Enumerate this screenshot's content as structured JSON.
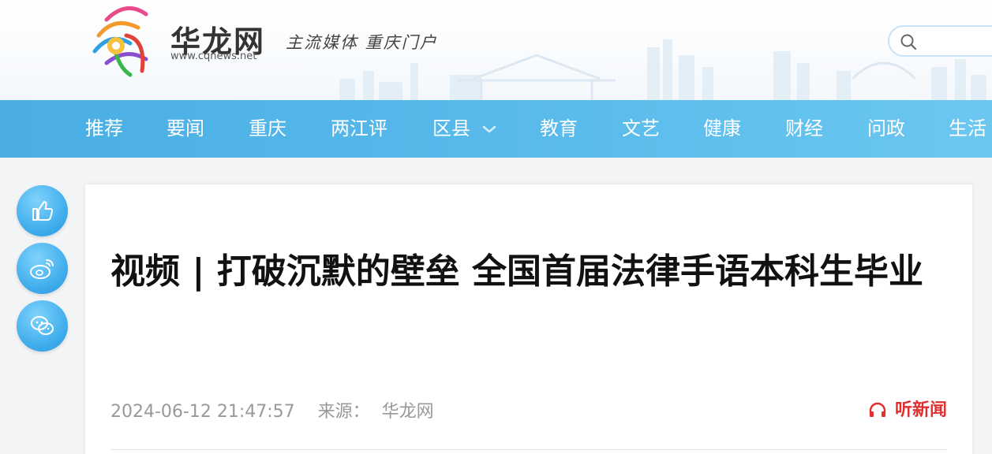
{
  "site": {
    "name": "华龙网",
    "url": "www.cqnews.net",
    "slogan": "主流媒体 重庆门户"
  },
  "search": {
    "placeholder": ""
  },
  "nav": {
    "items": [
      {
        "label": "推荐"
      },
      {
        "label": "要闻"
      },
      {
        "label": "重庆"
      },
      {
        "label": "两江评"
      },
      {
        "label": "区县",
        "has_dropdown": true
      },
      {
        "label": "教育"
      },
      {
        "label": "文艺"
      },
      {
        "label": "健康"
      },
      {
        "label": "财经"
      },
      {
        "label": "问政"
      },
      {
        "label": "生活"
      }
    ]
  },
  "share": {
    "items": [
      {
        "icon": "thumbs-up-icon"
      },
      {
        "icon": "weibo-icon"
      },
      {
        "icon": "wechat-icon"
      }
    ]
  },
  "article": {
    "title": "视频 | 打破沉默的壁垒 全国首届法律手语本科生毕业",
    "datetime": "2024-06-12 21:47:57",
    "source_label": "来源：",
    "source": "华龙网",
    "listen_label": "听新闻"
  },
  "colors": {
    "nav_bg": "#4aaee3",
    "listen": "#e02f2f",
    "share_btn": "#3aa9ea"
  }
}
